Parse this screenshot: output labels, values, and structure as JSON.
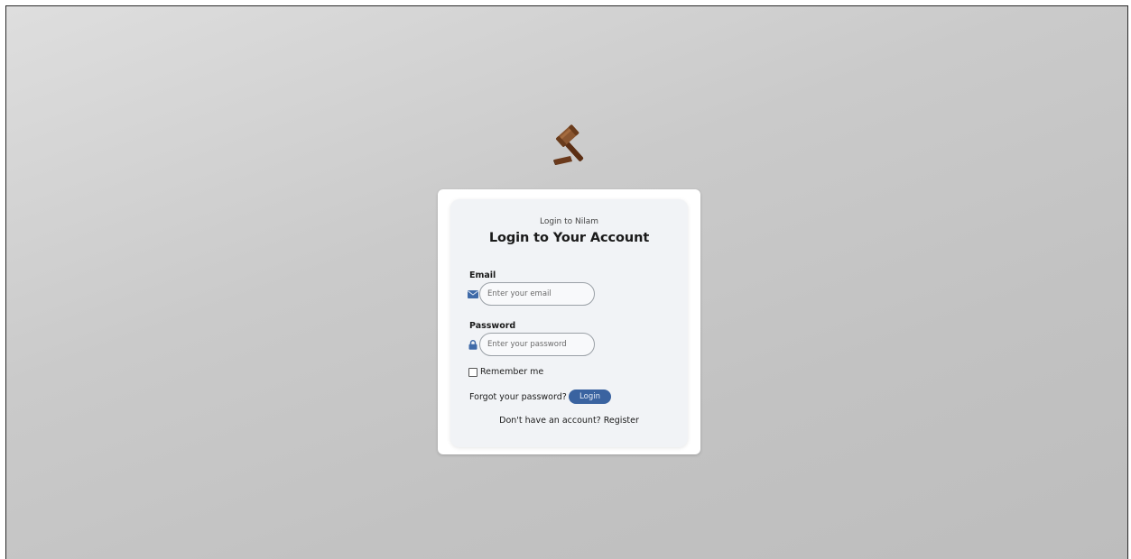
{
  "logo": {
    "icon": "gavel-icon",
    "colors": {
      "head": "#7a4a24",
      "handle": "#5c2f14",
      "base": "#6b3a1c"
    }
  },
  "card": {
    "subtitle": "Login to Nilam",
    "title": "Login to Your Account",
    "email": {
      "label": "Email",
      "placeholder": "Enter your email",
      "value": "",
      "icon": "envelope-icon"
    },
    "password": {
      "label": "Password",
      "placeholder": "Enter your password",
      "value": "",
      "icon": "lock-icon"
    },
    "remember_label": "Remember me",
    "remember_checked": false,
    "forgot_label": "Forgot your password?",
    "login_label": "Login",
    "register_prompt": "Don't have an account?",
    "register_link": "Register"
  },
  "colors": {
    "accent": "#3a63a0",
    "icon": "#3f6aa8",
    "card_bg": "#ffffff",
    "inner_bg": "#f1f3f6"
  }
}
